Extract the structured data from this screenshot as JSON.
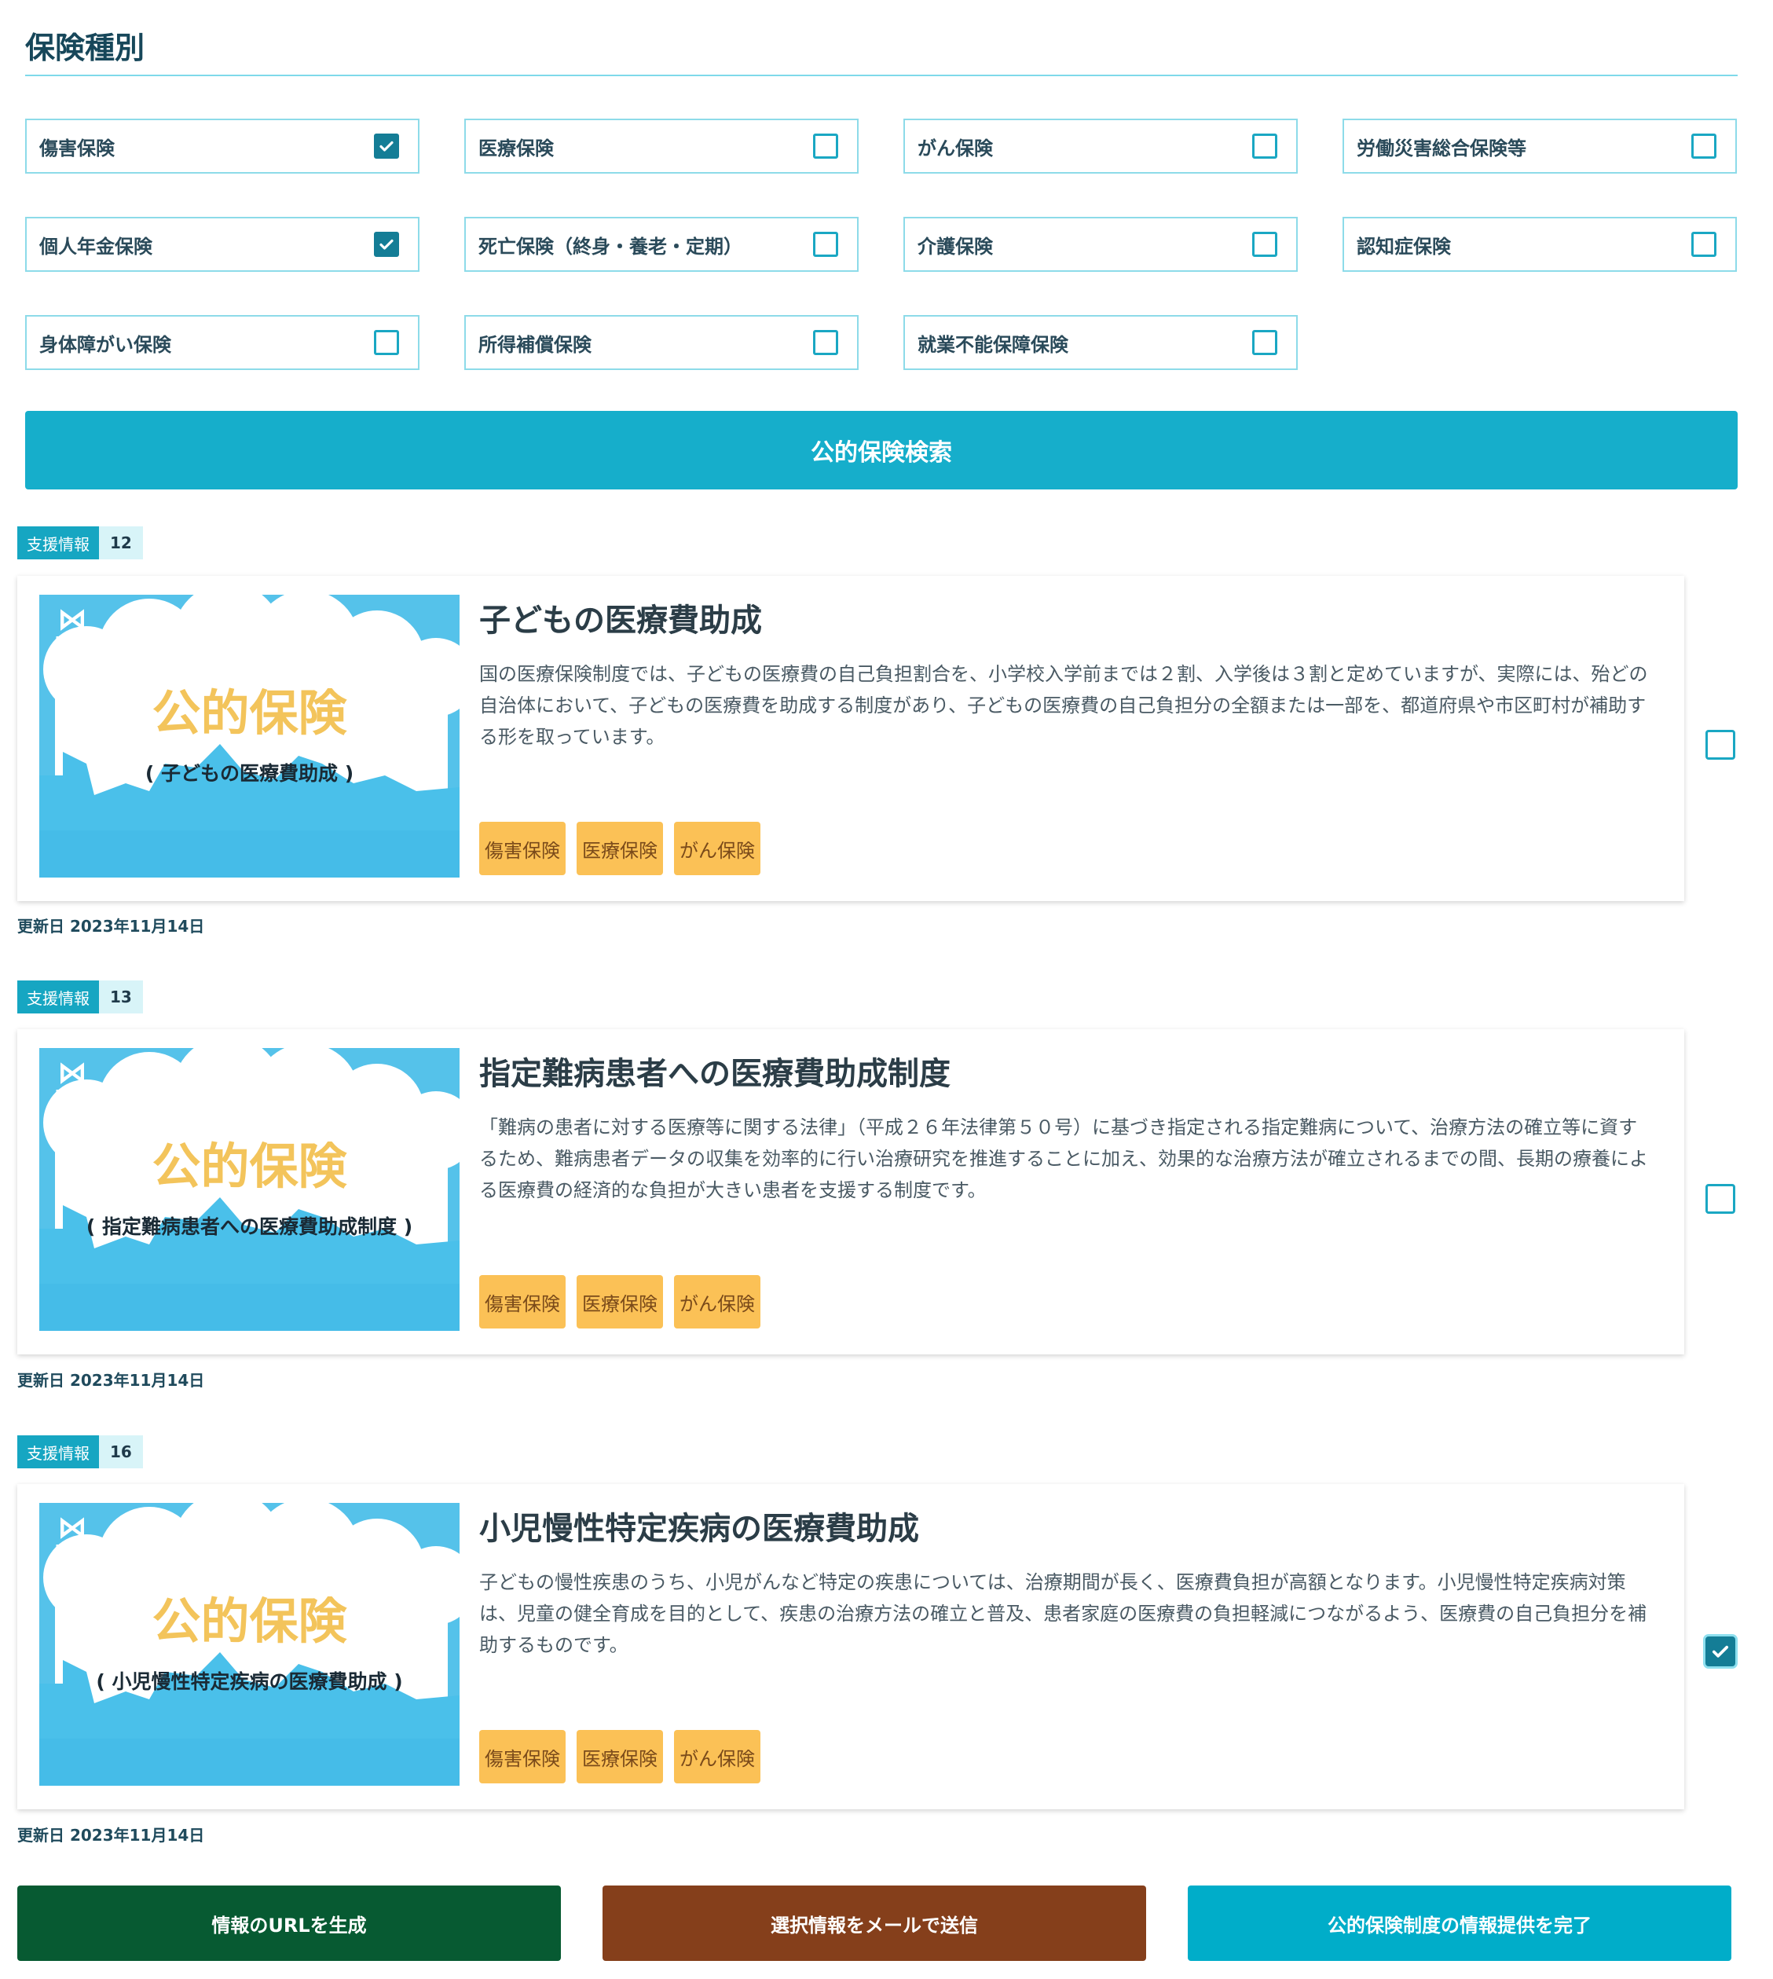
{
  "section": {
    "title": "保険種別"
  },
  "insurance_types": [
    {
      "label": "傷害保険",
      "checked": true
    },
    {
      "label": "医療保険",
      "checked": false
    },
    {
      "label": "がん保険",
      "checked": false
    },
    {
      "label": "労働災害総合保険等",
      "checked": false
    },
    {
      "label": "個人年金保険",
      "checked": true
    },
    {
      "label": "死亡保険（終身・養老・定期）",
      "checked": false
    },
    {
      "label": "介護保険",
      "checked": false
    },
    {
      "label": "認知症保険",
      "checked": false
    },
    {
      "label": "身体障がい保険",
      "checked": false
    },
    {
      "label": "所得補償保険",
      "checked": false
    },
    {
      "label": "就業不能保障保険",
      "checked": false
    }
  ],
  "search_button": "公的保険検索",
  "results": [
    {
      "badge_label": "支援情報",
      "badge_num": "12",
      "thumb": {
        "logo": "LIFE",
        "big": "公的保険",
        "sub": "( 子どもの医療費助成 )"
      },
      "title": "子どもの医療費助成",
      "description": "国の医療保険制度では、子どもの医療費の自己負担割合を、小学校入学前までは２割、入学後は３割と定めていますが、実際には、殆どの自治体において、子どもの医療費を助成する制度があり、子どもの医療費の自己負担分の全額または一部を、都道府県や市区町村が補助する形を取っています。",
      "tags": [
        "傷害保険",
        "医療保険",
        "がん保険"
      ],
      "selected": false,
      "updated": "更新日 2023年11月14日"
    },
    {
      "badge_label": "支援情報",
      "badge_num": "13",
      "thumb": {
        "logo": "LIFE",
        "big": "公的保険",
        "sub": "( 指定難病患者への医療費助成制度 )"
      },
      "title": "指定難病患者への医療費助成制度",
      "description": "「難病の患者に対する医療等に関する法律」（平成２６年法律第５０号）に基づき指定される指定難病について、治療方法の確立等に資するため、難病患者データの収集を効率的に行い治療研究を推進することに加え、効果的な治療方法が確立されるまでの間、長期の療養による医療費の経済的な負担が大きい患者を支援する制度です。",
      "tags": [
        "傷害保険",
        "医療保険",
        "がん保険"
      ],
      "selected": false,
      "updated": "更新日 2023年11月14日"
    },
    {
      "badge_label": "支援情報",
      "badge_num": "16",
      "thumb": {
        "logo": "LIFE",
        "big": "公的保険",
        "sub": "( 小児慢性特定疾病の医療費助成 )"
      },
      "title": "小児慢性特定疾病の医療費助成",
      "description": "子どもの慢性疾患のうち、小児がんなど特定の疾患については、治療期間が長く、医療費負担が高額となります。小児慢性特定疾病対策は、児童の健全育成を目的として、疾患の治療方法の確立と普及、患者家庭の医療費の負担軽減につながるよう、医療費の自己負担分を補助するものです。",
      "tags": [
        "傷害保険",
        "医療保険",
        "がん保険"
      ],
      "selected": true,
      "updated": "更新日 2023年11月14日"
    }
  ],
  "actions": {
    "generate_url": "情報のURLを生成",
    "send_email": "選択情報をメールで送信",
    "complete": "公的保険制度の情報提供を完了"
  },
  "colors": {
    "accent": "#16aecb",
    "tag": "#fbc156",
    "btn_green": "#075a32",
    "btn_brown": "#853f1b",
    "btn_teal": "#00adc9"
  }
}
